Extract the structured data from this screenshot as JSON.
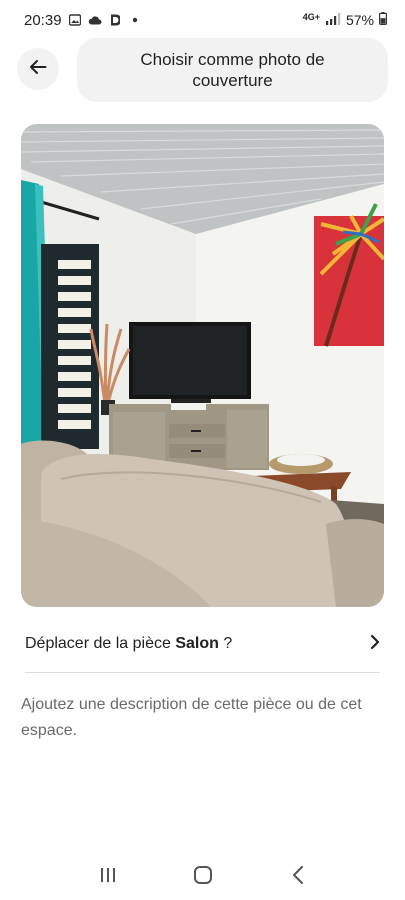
{
  "status_bar": {
    "time": "20:39",
    "left_icons": [
      "image-icon",
      "cloud-icon",
      "app-icon",
      "dot-icon"
    ],
    "network": "4G+",
    "battery": "57%"
  },
  "header": {
    "back_icon": "arrow-left-icon",
    "cover_button_label": "Choisir comme photo de couverture"
  },
  "photo": {
    "description_hidden": ""
  },
  "move_room": {
    "prefix": "Déplacer de la pièce ",
    "room": "Salon",
    "suffix": " ?",
    "icon": "chevron-right-icon"
  },
  "description": {
    "placeholder": "Ajoutez une description de cette pièce ou de cet espace."
  },
  "nav_bar": {
    "icons": [
      "recent-apps-icon",
      "home-icon",
      "back-icon"
    ]
  }
}
